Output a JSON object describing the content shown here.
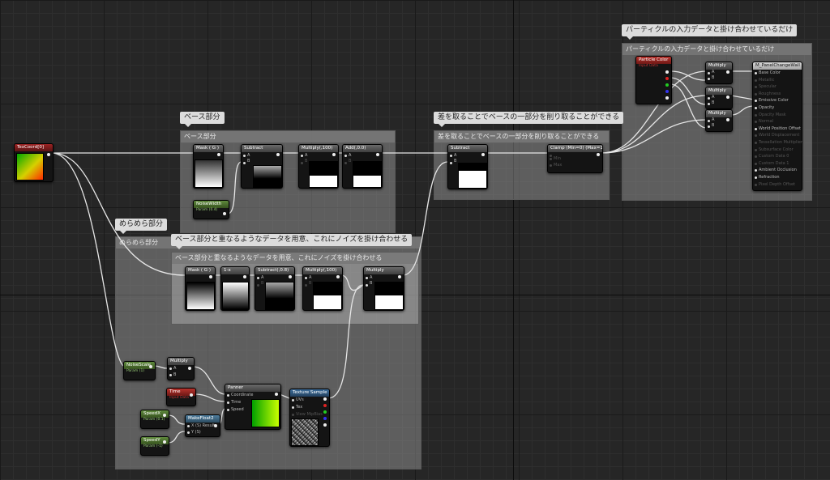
{
  "comments": {
    "base": {
      "bubble": "ベース部分",
      "header": "ベース部分"
    },
    "diff": {
      "bubble": "差を取ることでベースの一部分を削り取ることができる",
      "header": "差を取ることでベースの一部分を削り取ることができる"
    },
    "particle": {
      "bubble": "パーティクルの入力データと掛け合わせているだけ",
      "header": "パーティクルの入力データと掛け合わせているだけ"
    },
    "flicker": {
      "bubble": "めらめら部分",
      "header": "めらめら部分"
    },
    "overlap": {
      "bubble": "ベース部分と重なるようなデータを用意、これにノイズを掛け合わせる",
      "header": "ベース部分と重なるようなデータを用意、これにノイズを掛け合わせる"
    }
  },
  "nodes": {
    "texcoord": {
      "title": "TexCoord[0]"
    },
    "mask_g": {
      "title": "Mask ( G )"
    },
    "subtract1": {
      "title": "Subtract",
      "pin_a": "A",
      "pin_b": "B"
    },
    "multiply_100_a": {
      "title": "Multiply(,100)",
      "pin_a": "A",
      "pin_b": "B"
    },
    "add_0_0": {
      "title": "Add(,0.0)",
      "pin_a": "A",
      "pin_b": "B"
    },
    "noise_width": {
      "title": "NoiseWidth",
      "subtitle": "Param (0.4)"
    },
    "subtract_diff": {
      "title": "Subtract",
      "pin_a": "A",
      "pin_b": "B"
    },
    "clamp": {
      "title": "Clamp (Min=0) (Max=1)",
      "pin_min": "Min",
      "pin_max": "Max"
    },
    "particle_color": {
      "title": "Particle Color",
      "subtitle": "Input Data"
    },
    "multiply_p1": {
      "title": "Multiply",
      "pin_a": "A",
      "pin_b": "B"
    },
    "multiply_p2": {
      "title": "Multiply",
      "pin_a": "A",
      "pin_b": "B"
    },
    "multiply_p3": {
      "title": "Multiply",
      "pin_a": "A",
      "pin_b": "B"
    },
    "material": {
      "title": "M_PanelChangeWall",
      "pins": [
        "Base Color",
        "Metallic",
        "Specular",
        "Roughness",
        "Emissive Color",
        "Opacity",
        "Opacity Mask",
        "Normal",
        "World Position Offset",
        "World Displacement",
        "Tessellation Multiplier",
        "Subsurface Color",
        "Custom Data 0",
        "Custom Data 1",
        "Ambient Occlusion",
        "Refraction",
        "Pixel Depth Offset"
      ],
      "active": [
        0,
        4,
        5,
        8,
        14,
        15
      ]
    },
    "mask_g2": {
      "title": "Mask ( G )"
    },
    "one_minus": {
      "title": "1-x"
    },
    "subtract_0_8": {
      "title": "Subtract(,0.8)",
      "pin_a": "A",
      "pin_b": "B"
    },
    "multiply_100_b": {
      "title": "Multiply(,100)",
      "pin_a": "A",
      "pin_b": "B"
    },
    "multiply_noise": {
      "title": "Multiply",
      "pin_a": "A",
      "pin_b": "B"
    },
    "noise_scale": {
      "title": "NoiseScale",
      "subtitle": "Param (1)"
    },
    "multiply_scale": {
      "title": "Multiply",
      "pin_a": "A",
      "pin_b": "B"
    },
    "time": {
      "title": "Time",
      "subtitle": "Input Data"
    },
    "panner": {
      "title": "Panner",
      "pins": [
        "Coordinate",
        "Time",
        "Speed"
      ]
    },
    "texture_sample": {
      "title": "Texture Sample",
      "pins": [
        "UVs",
        "Tex",
        "View MipBias"
      ]
    },
    "speed_x": {
      "title": "SpeedX",
      "subtitle": "Param (0.1)"
    },
    "speed_y": {
      "title": "SpeedY",
      "subtitle": "Param (-1)"
    },
    "make_float2": {
      "title": "MakeFloat2",
      "pin_x": "X (S) Result",
      "pin_y": "Y (S)"
    }
  }
}
